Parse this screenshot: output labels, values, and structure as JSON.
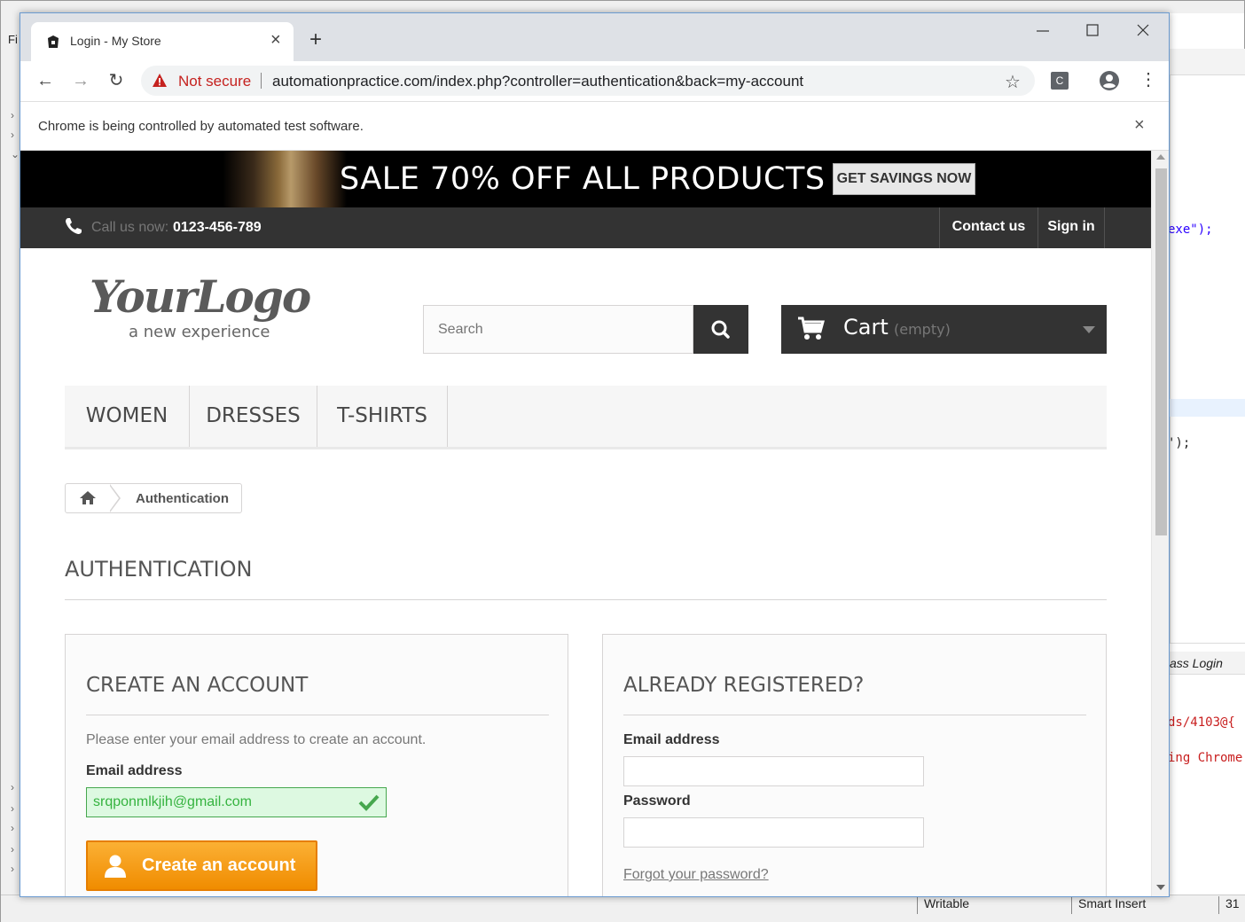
{
  "ide": {
    "menu_first": "Fi",
    "code_line_1": "exe\");",
    "code_line_2": "');",
    "console_tab": "ass Login",
    "console_line_1": "ds/4103@{",
    "console_line_2": "ing Chrome",
    "status_writable": "Writable",
    "status_insert": "Smart Insert",
    "status_line": "31"
  },
  "browser": {
    "tab_title": "Login - My Store",
    "new_tab_icon": "plus-icon",
    "security_label": "Not secure",
    "url": "automationpractice.com/index.php?controller=authentication&back=my-account",
    "extension_label": "C",
    "infobar_text": "Chrome is being controlled by automated test software."
  },
  "page": {
    "banner": {
      "headline": "SALE 70% OFF ALL PRODUCTS",
      "button": "GET SAVINGS NOW"
    },
    "topbar": {
      "call_label": "Call us now:",
      "phone": "0123-456-789",
      "contact": "Contact us",
      "sign_in": "Sign in"
    },
    "logo": {
      "main": "YourLogo",
      "tagline": "a new experience"
    },
    "search": {
      "placeholder": "Search"
    },
    "cart": {
      "label": "Cart",
      "status": "(empty)"
    },
    "menu": [
      "WOMEN",
      "DRESSES",
      "T-SHIRTS"
    ],
    "breadcrumb": {
      "current": "Authentication"
    },
    "heading": "AUTHENTICATION",
    "create_account": {
      "title": "CREATE AN ACCOUNT",
      "description": "Please enter your email address to create an account.",
      "email_label": "Email address",
      "email_value": "srqponmlkjih@gmail.com",
      "button": "Create an account"
    },
    "login": {
      "title": "ALREADY REGISTERED?",
      "email_label": "Email address",
      "password_label": "Password",
      "forgot": "Forgot your password?"
    }
  },
  "colors": {
    "accent_orange": "#f5a623",
    "dark_bar": "#333333",
    "valid_green": "#35b33f",
    "warning_red": "#c5221f"
  }
}
